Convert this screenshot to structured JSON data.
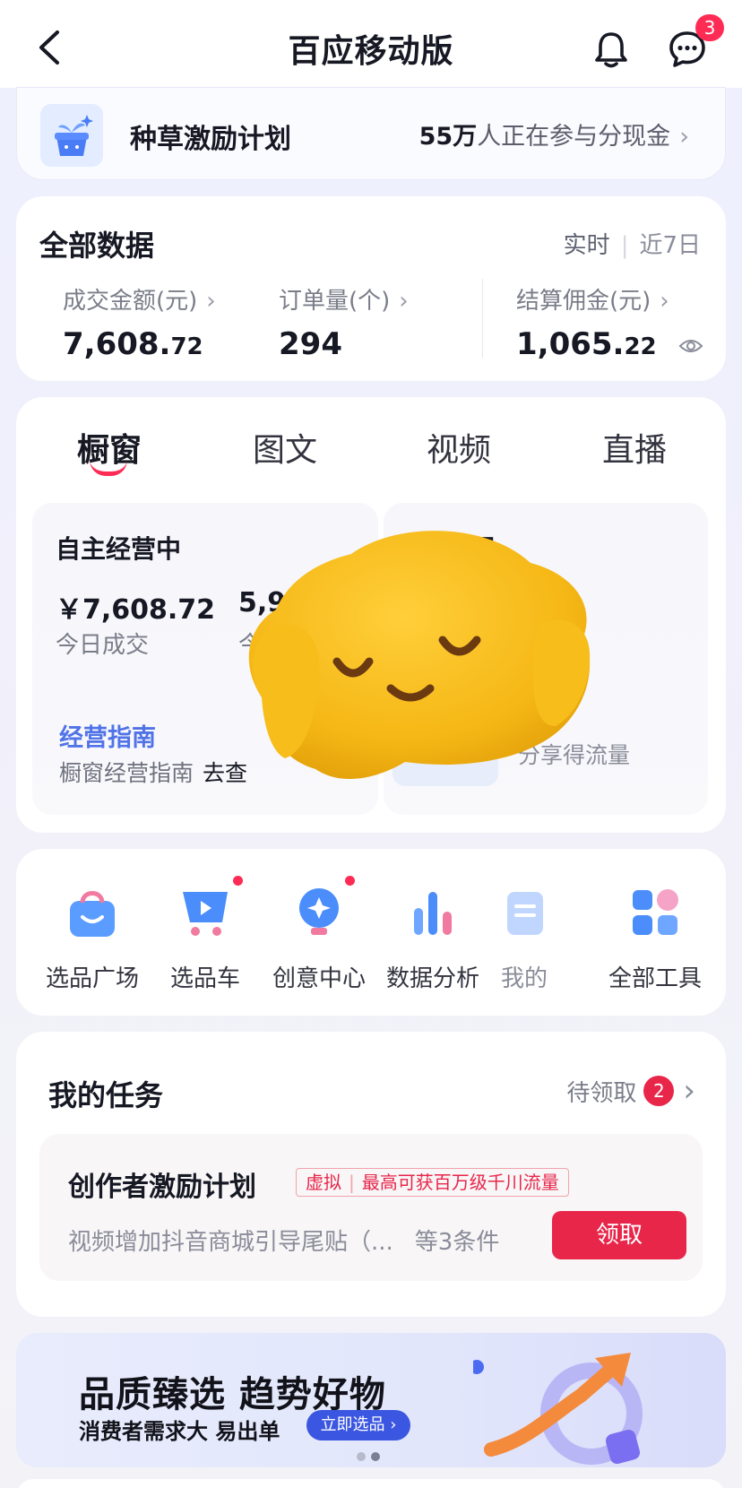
{
  "header": {
    "title": "百应移动版",
    "message_badge": "3"
  },
  "promo": {
    "title": "种草激励计划",
    "count": "55万",
    "suffix": "人正在参与分现金"
  },
  "stats": {
    "title": "全部数据",
    "toggle_realtime": "实时",
    "toggle_7d": "近7日",
    "metrics": [
      {
        "label": "成交金额(元)",
        "value_main": "7,608.",
        "value_dec": "72"
      },
      {
        "label": "订单量(个)",
        "value_main": "294",
        "value_dec": ""
      },
      {
        "label": "结算佣金(元)",
        "value_main": "1,065.",
        "value_dec": "22"
      }
    ]
  },
  "tabs": [
    "橱窗",
    "图文",
    "视频",
    "直播"
  ],
  "panel_a": {
    "title": "自主经营中",
    "value1": "￥7,608.72",
    "label1": "今日成交",
    "value2": "5,93",
    "label2": "今",
    "guide_title": "经营指南",
    "guide_text": "橱窗经营指南",
    "guide_link": "去查"
  },
  "panel_b": {
    "title_partial": "管理",
    "text_partial": "理",
    "label": "分享得流量"
  },
  "tools": [
    {
      "label": "选品广场",
      "icon": "bag-icon",
      "dot": false
    },
    {
      "label": "选品车",
      "icon": "cart-icon",
      "dot": true
    },
    {
      "label": "创意中心",
      "icon": "bulb-icon",
      "dot": true
    },
    {
      "label": "数据分析",
      "icon": "bars-icon",
      "dot": false
    },
    {
      "label": "我的",
      "icon": "doc-icon",
      "dot": false
    },
    {
      "label": "全部工具",
      "icon": "grid-icon",
      "dot": false
    }
  ],
  "tasks": {
    "title": "我的任务",
    "pending_label": "待领取",
    "pending_count": "2",
    "item": {
      "name": "创作者激励计划",
      "tag1": "虚拟",
      "tag2": "最高可获百万级千川流量",
      "desc": "视频增加抖音商城引导尾贴（...",
      "cond": "等3条件",
      "button": "领取"
    }
  },
  "banner": {
    "title": "品质臻选  趋势好物",
    "subtitle": "消费者需求大   易出单",
    "button": "立即选品",
    "button_arrow": "›"
  },
  "colors": {
    "accent_red": "#fe2c55",
    "link_blue": "#5173e8",
    "banner_blue": "#3b56e0"
  }
}
